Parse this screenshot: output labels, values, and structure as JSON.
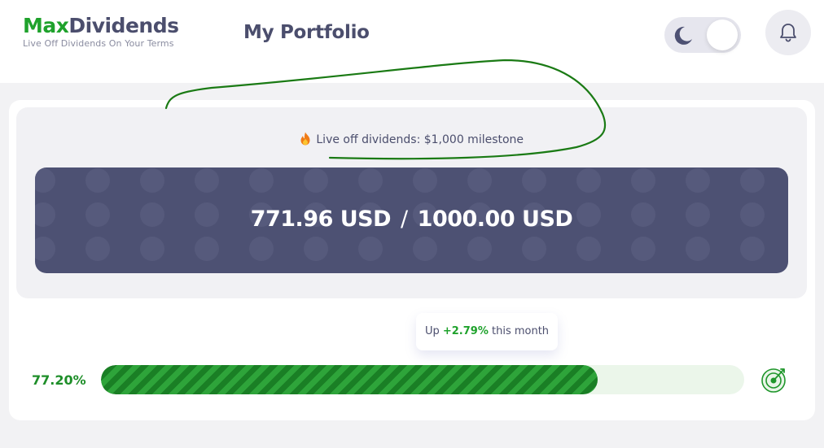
{
  "header": {
    "brand_part1": "Max",
    "brand_part2": "Dividends",
    "tagline": "Live Off Dividends On Your Terms",
    "page_title": "My Portfolio",
    "theme_toggle_icon": "moon-icon",
    "notifications_icon": "bell-icon"
  },
  "milestone": {
    "icon": "fire-icon",
    "label": "Live off dividends: $1,000 milestone",
    "current_amount": "771.96 USD",
    "separator": "/",
    "target_amount": "1000.00 USD"
  },
  "tooltip": {
    "prefix": "Up",
    "change": "+2.79%",
    "suffix": "this month"
  },
  "progress": {
    "percent_label": "77.20%",
    "fraction": 0.772,
    "goal_icon": "target-icon"
  },
  "colors": {
    "brand_green": "#1fa22c",
    "brand_text": "#4b4e6d",
    "amount_box": "#4d5173",
    "progress_fill": "#1f962b",
    "progress_track": "#ebf6ea",
    "annotation_ink": "#1a7a14"
  }
}
